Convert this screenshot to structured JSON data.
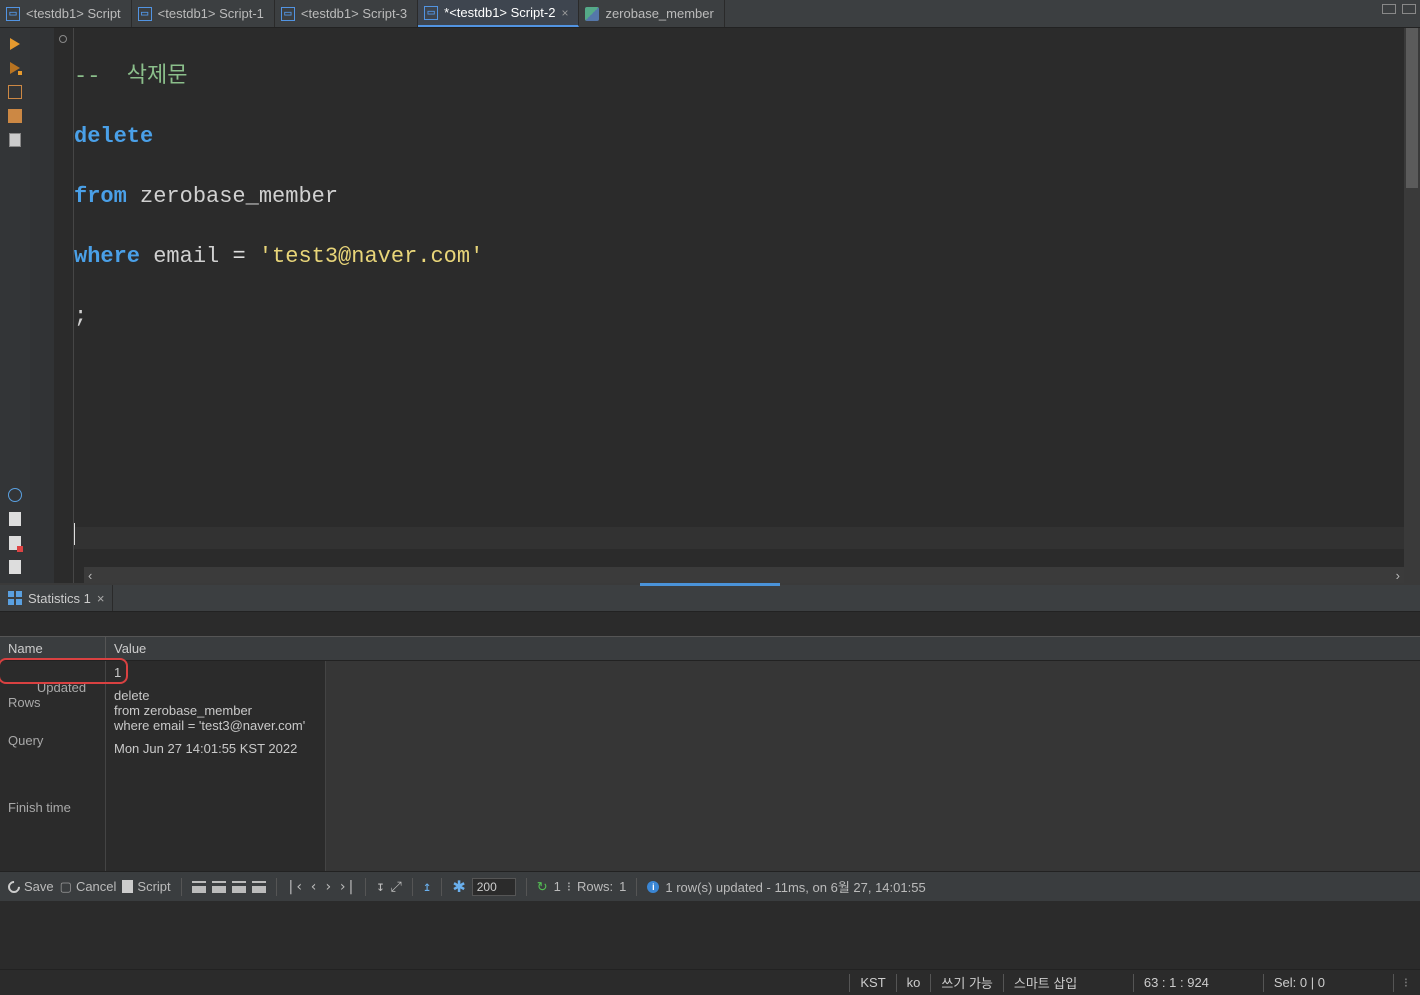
{
  "tabs": [
    {
      "label": "<testdb1> Script"
    },
    {
      "label": "<testdb1> Script-1"
    },
    {
      "label": "<testdb1> Script-3"
    },
    {
      "label": "*<testdb1> Script-2",
      "active": true
    },
    {
      "label": "zerobase_member",
      "plain": true
    }
  ],
  "editor": {
    "comment": "--  삭제문",
    "kw_delete": "delete",
    "kw_from": "from",
    "tbl": " zerobase_member",
    "kw_where": "where",
    "col_expr": " email ",
    "op_eq": "=",
    "sp": " ",
    "string": "'test3@naver.com'",
    "semicolon": ";"
  },
  "panel": {
    "tab_label": "Statistics 1",
    "head_name": "Name",
    "head_value": "Value",
    "rows": {
      "updated_name": "Updated Rows",
      "updated_val": "1",
      "query_name": "Query",
      "query_val": "delete\nfrom zerobase_member\nwhere email = 'test3@naver.com'",
      "finish_name": "Finish time",
      "finish_val": "Mon Jun 27 14:01:55 KST 2022"
    }
  },
  "toolbar": {
    "save": "Save",
    "cancel": "Cancel",
    "script": "Script",
    "max_rows": "200",
    "rows_label": "Rows:",
    "rows_count": "1",
    "refresh_one": "1",
    "message": "1 row(s) updated - 11ms, on 6월 27, 14:01:55"
  },
  "statusbar": {
    "tz": "KST",
    "lang": "ko",
    "writable": "쓰기 가능",
    "insert": "스마트 삽입",
    "pos": "63 : 1 : 924",
    "sel": "Sel: 0 | 0"
  },
  "hscroll": {
    "left": "‹",
    "right": "›"
  }
}
